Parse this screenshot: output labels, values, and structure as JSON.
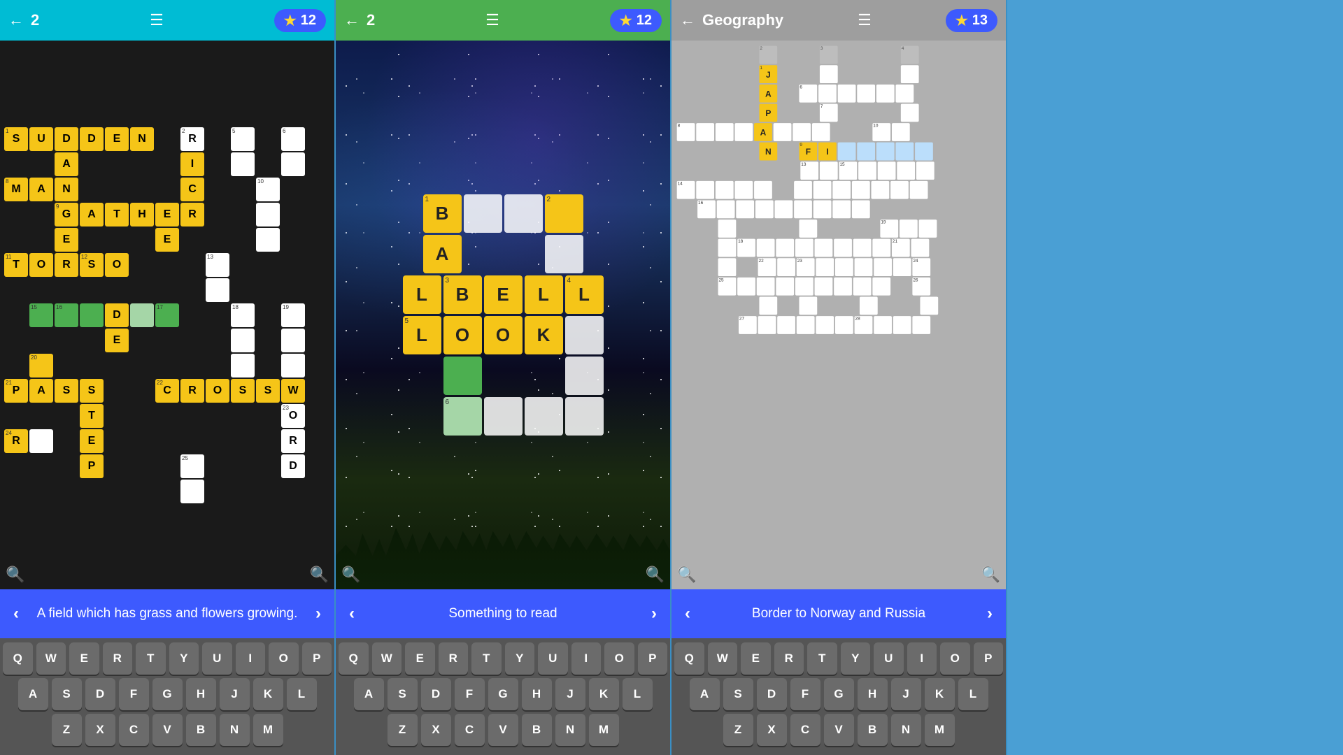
{
  "panels": [
    {
      "id": "panel-1",
      "header": {
        "color": "cyan",
        "back_label": "←",
        "level": "2",
        "menu_label": "☰",
        "stars": "12"
      },
      "hint": {
        "prev": "‹",
        "text": "A field which has grass and flowers growing.",
        "next": "›"
      },
      "keyboard": {
        "rows": [
          [
            "Q",
            "W",
            "E",
            "R",
            "T",
            "Y",
            "U",
            "I",
            "O",
            "P"
          ],
          [
            "A",
            "S",
            "D",
            "F",
            "G",
            "H",
            "J",
            "K",
            "L"
          ],
          [
            "Z",
            "X",
            "C",
            "V",
            "B",
            "N",
            "M"
          ]
        ]
      },
      "zoom_in": "🔍",
      "zoom_out": "🔍"
    },
    {
      "id": "panel-2",
      "header": {
        "color": "green",
        "back_label": "←",
        "level": "2",
        "menu_label": "☰",
        "stars": "12"
      },
      "hint": {
        "prev": "‹",
        "text": "Something to read",
        "next": "›"
      },
      "keyboard": {
        "rows": [
          [
            "Q",
            "W",
            "E",
            "R",
            "T",
            "Y",
            "U",
            "I",
            "O",
            "P"
          ],
          [
            "A",
            "S",
            "D",
            "F",
            "G",
            "H",
            "J",
            "K",
            "L"
          ],
          [
            "Z",
            "X",
            "C",
            "V",
            "B",
            "N",
            "M"
          ]
        ]
      },
      "zoom_in": "🔍",
      "zoom_out": "🔍"
    },
    {
      "id": "panel-3",
      "header": {
        "color": "gray",
        "back_label": "←",
        "title": "Geography",
        "menu_label": "☰",
        "stars": "13"
      },
      "hint": {
        "prev": "‹",
        "text": "Border to Norway and Russia",
        "next": "›"
      },
      "keyboard": {
        "rows": [
          [
            "Q",
            "W",
            "E",
            "R",
            "T",
            "Y",
            "U",
            "I",
            "O",
            "P"
          ],
          [
            "A",
            "S",
            "D",
            "F",
            "G",
            "H",
            "J",
            "K",
            "L"
          ],
          [
            "Z",
            "X",
            "C",
            "V",
            "B",
            "N",
            "M"
          ]
        ]
      },
      "zoom_in": "🔍",
      "zoom_out": "🔍"
    }
  ]
}
